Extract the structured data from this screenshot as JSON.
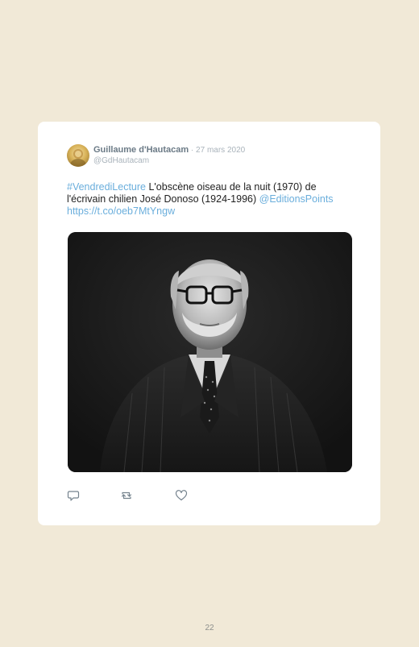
{
  "tweet": {
    "author_name": "Guillaume d'Hautacam",
    "separator": " · ",
    "date": "27 mars 2020",
    "handle": "@GdHautacam",
    "hashtag": "#VendrediLecture",
    "text": " L'obscène oiseau de la nuit (1970) de l'écrivain chilien José Donoso (1924-1996) ",
    "mention": "@EditionsPoints",
    "url": "https://t.co/oeb7MtYngw",
    "link_color": "#6aaedc"
  },
  "actions": {
    "reply_icon": "reply-icon",
    "retweet_icon": "retweet-icon",
    "like_icon": "heart-icon"
  },
  "page": {
    "number": "22"
  }
}
